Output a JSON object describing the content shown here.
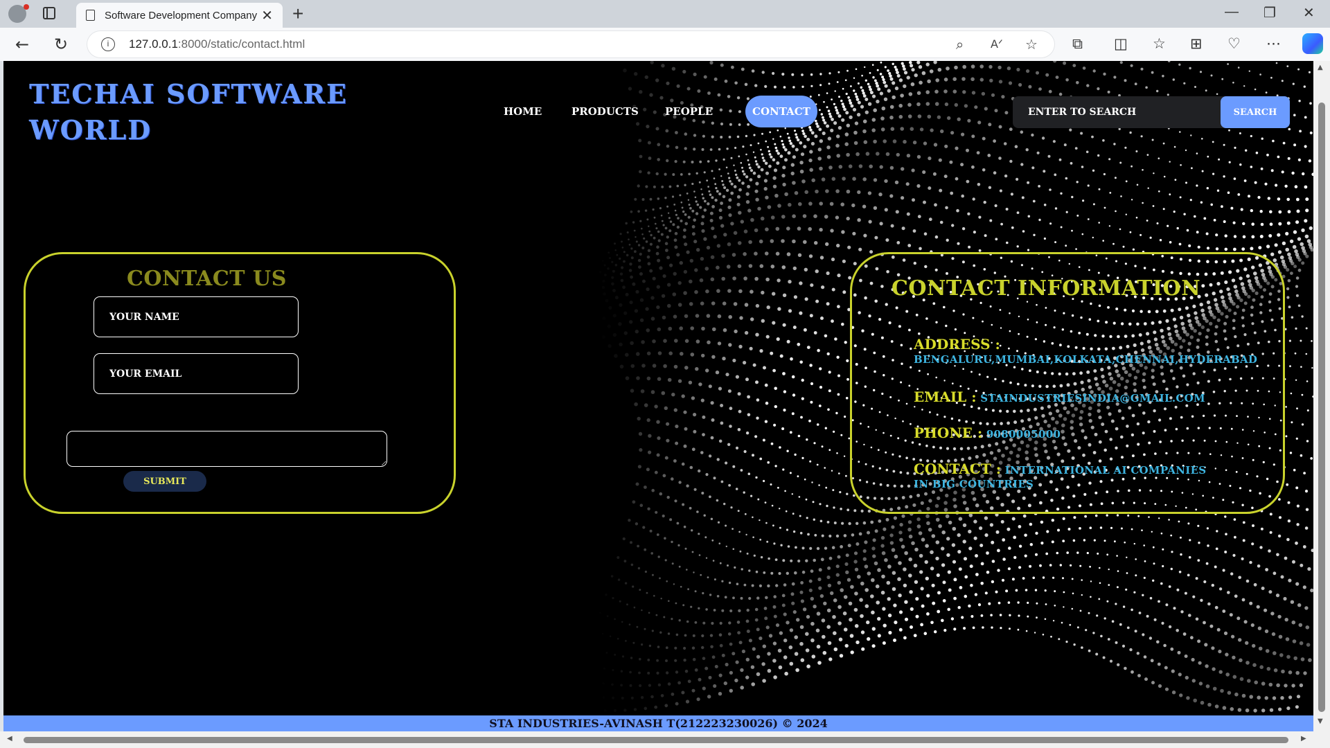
{
  "browser": {
    "tab_title": "Software Development Company",
    "tab_close": "✕",
    "new_tab": "+",
    "url_host": "127.0.0.1",
    "url_path": ":8000/static/contact.html",
    "win_minimize": "—",
    "win_restore": "❐",
    "win_close": "✕"
  },
  "page": {
    "brand": "TECHAI SOFTWARE WORLD",
    "nav": [
      {
        "label": "HOME"
      },
      {
        "label": "PRODUCTS"
      },
      {
        "label": "PEOPLE"
      },
      {
        "label": "CONTACT",
        "active": true
      }
    ],
    "search": {
      "placeholder": "ENTER TO SEARCH",
      "button": "SEARCH"
    },
    "contact_form": {
      "title": "CONTACT US",
      "name_placeholder": "YOUR NAME",
      "email_placeholder": "YOUR EMAIL",
      "submit": "SUBMIT"
    },
    "contact_info": {
      "title": "CONTACT INFORMATION",
      "address_label": "ADDRESS :",
      "address_value": "BENGALURU,MUMBAI,KOLKATA,CHENNAI,HYDERABAD",
      "email_label": "EMAIL :",
      "email_value": "STAINDUSTRIESINDIA@GMAIL.COM",
      "phone_label": "PHONE :",
      "phone_value": "9080005000",
      "contact_label": "CONTACT :",
      "contact_value_1": "INTERNATIONAL AI COMPANIES",
      "contact_value_2": "IN BIG COUNTRIES"
    },
    "footer": "STA INDUSTRIES-AVINASH T(212223230026) © 2024"
  },
  "colors": {
    "accent": "#6b9bff",
    "card_border": "#c9d22c",
    "info_value": "#3db4e0",
    "page_bg": "#000000"
  }
}
